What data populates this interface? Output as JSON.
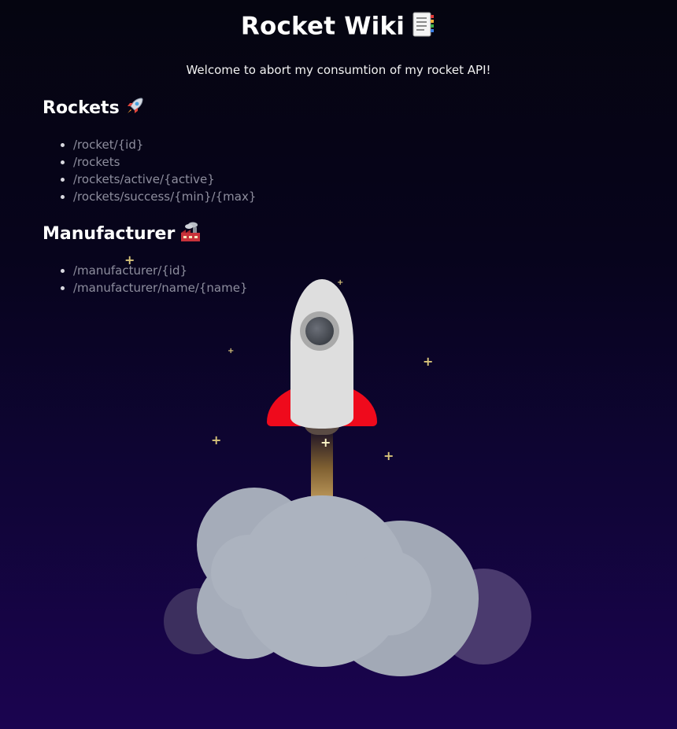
{
  "header": {
    "title": "Rocket Wiki",
    "title_icon": "memo-emoji",
    "subtitle": "Welcome to abort my consumtion of my rocket API!"
  },
  "sections": [
    {
      "heading": "Rockets",
      "heading_icon": "rocket-emoji",
      "endpoints": [
        "/rocket/{id}",
        "/rockets",
        "/rockets/active/{active}",
        "/rockets/success/{min}/{max}"
      ]
    },
    {
      "heading": "Manufacturer",
      "heading_icon": "factory-emoji",
      "endpoints": [
        "/manufacturer/{id}",
        "/manufacturer/name/{name}"
      ]
    }
  ],
  "colors": {
    "background_top": "#050510",
    "background_bottom": "#1b0450",
    "endpoint_text": "#8e8e9e",
    "rocket_body": "#dedede",
    "rocket_fins": "#ef0a1c",
    "smoke": "#a9b0bd",
    "stars": "#d8c47a"
  }
}
